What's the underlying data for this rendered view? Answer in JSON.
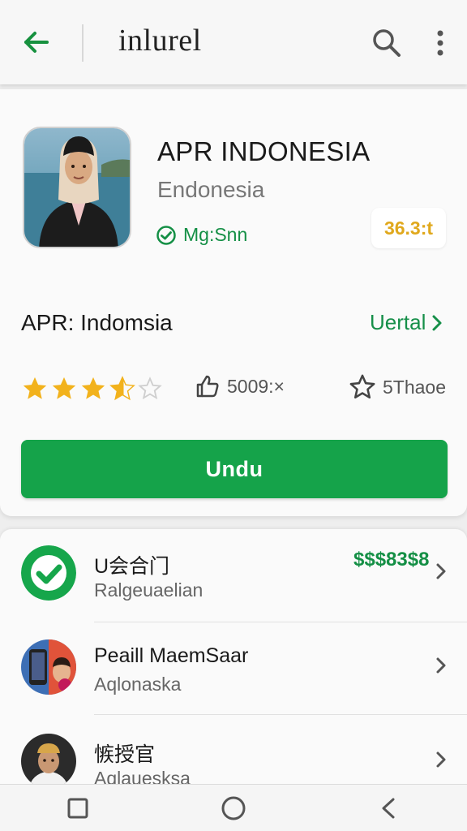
{
  "header": {
    "title": "inlurel",
    "back_icon": "arrow-left-icon",
    "search_icon": "search-icon",
    "menu_icon": "more-vertical-icon"
  },
  "profile": {
    "name": "APR INDONESIA",
    "subtitle": "Endonesia",
    "verified_text": "Mg:Snn",
    "score": "36.3:t"
  },
  "section": {
    "label": "APR: Indomsia",
    "detail_link": "Uertal"
  },
  "rating": {
    "stars": 3.5,
    "max_stars": 5,
    "likes": "5009:×",
    "share": "5Thaoe"
  },
  "download": {
    "label": "Undu"
  },
  "list": {
    "items": [
      {
        "title": "U会合门",
        "subtitle": "Ralgeuaelian",
        "price": "$$$83$8",
        "avatar": "check-circle-icon"
      },
      {
        "title": "Peaill MaemSaar",
        "subtitle": "Aqlonaska",
        "price": "",
        "avatar": "person-photo"
      },
      {
        "title": "愱授官",
        "subtitle": "Aqlauesksa",
        "price": "",
        "avatar": "person-photo"
      }
    ]
  },
  "navbar": {
    "recents_icon": "square-icon",
    "home_icon": "circle-icon",
    "back_icon": "triangle-back-icon"
  },
  "colors": {
    "accent_green": "#15a34a",
    "star_gold": "#f2b21c",
    "score_orange": "#e0a81c"
  }
}
